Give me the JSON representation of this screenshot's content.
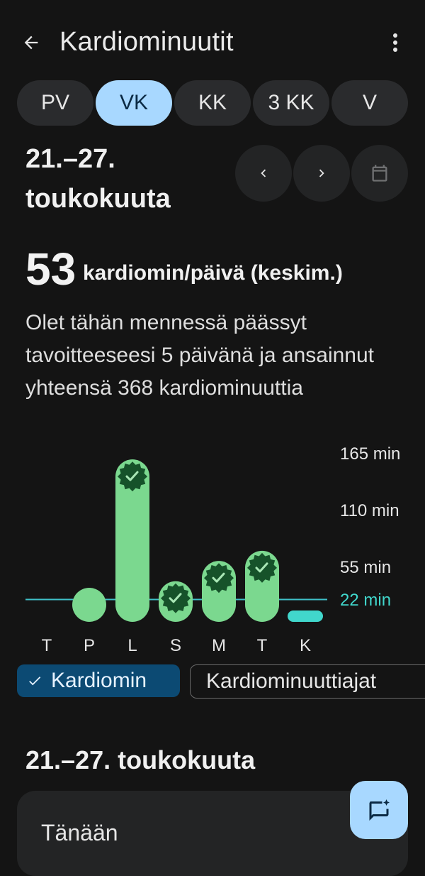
{
  "header": {
    "title": "Kardiominuutit",
    "back_icon": "arrow-left-icon",
    "menu_icon": "more-vert-icon"
  },
  "tabs": [
    {
      "label": "PV",
      "active": false
    },
    {
      "label": "VK",
      "active": true
    },
    {
      "label": "KK",
      "active": false
    },
    {
      "label": "3 KK",
      "active": false
    },
    {
      "label": "V",
      "active": false
    }
  ],
  "range": {
    "line1": "21.–27.",
    "line2": "toukokuuta"
  },
  "summary": {
    "value": "53",
    "unit": "kardiomin/päivä (keskim.)",
    "description": "Olet tähän mennessä päässyt tavoitteeseesi 5 päivänä ja ansainnut yhteensä 368 kardiominuuttia"
  },
  "chart": {
    "yticks": [
      "165 min",
      "110 min",
      "55 min"
    ],
    "goal_label": "22 min",
    "days": [
      "T",
      "P",
      "L",
      "S",
      "M",
      "T",
      "K"
    ]
  },
  "chart_data": {
    "type": "bar",
    "categories": [
      "T",
      "P",
      "L",
      "S",
      "M",
      "T",
      "K"
    ],
    "values": [
      0,
      20,
      160,
      40,
      60,
      70,
      1
    ],
    "goal": 22,
    "goal_met": [
      false,
      false,
      true,
      true,
      true,
      true,
      false
    ],
    "ylim": [
      0,
      165
    ],
    "ytick_values": [
      55,
      110,
      165
    ],
    "colors": {
      "bar": "#7bd88f",
      "today": "#41d7cc",
      "goal": "#3fc1c9",
      "badge": "#16522a"
    }
  },
  "chips": {
    "cardio": "Kardiomin",
    "times": "Kardiominuuttiajat"
  },
  "section": {
    "title": "21.–27. toukokuuta",
    "today": "Tänään"
  }
}
